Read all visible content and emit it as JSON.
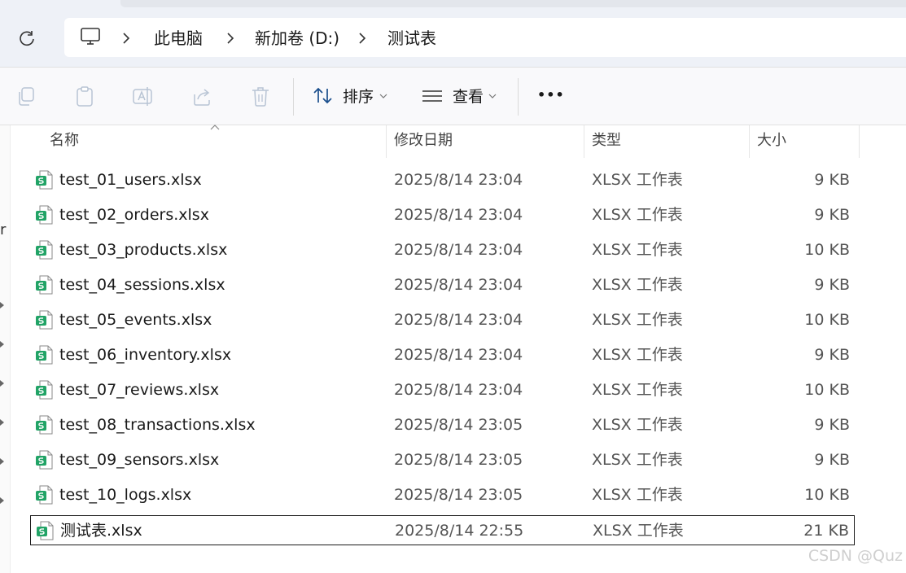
{
  "breadcrumb": {
    "items": [
      "此电脑",
      "新加卷 (D:)",
      "测试表"
    ]
  },
  "toolbar": {
    "sort_label": "排序",
    "view_label": "查看",
    "more_label": "•••"
  },
  "left_nav": {
    "partial_letter": "r"
  },
  "columns": {
    "name": "名称",
    "modified": "修改日期",
    "type": "类型",
    "size": "大小"
  },
  "files": [
    {
      "name": "test_01_users.xlsx",
      "modified": "2025/8/14 23:04",
      "type": "XLSX 工作表",
      "size": "9 KB"
    },
    {
      "name": "test_02_orders.xlsx",
      "modified": "2025/8/14 23:04",
      "type": "XLSX 工作表",
      "size": "9 KB"
    },
    {
      "name": "test_03_products.xlsx",
      "modified": "2025/8/14 23:04",
      "type": "XLSX 工作表",
      "size": "10 KB"
    },
    {
      "name": "test_04_sessions.xlsx",
      "modified": "2025/8/14 23:04",
      "type": "XLSX 工作表",
      "size": "9 KB"
    },
    {
      "name": "test_05_events.xlsx",
      "modified": "2025/8/14 23:04",
      "type": "XLSX 工作表",
      "size": "10 KB"
    },
    {
      "name": "test_06_inventory.xlsx",
      "modified": "2025/8/14 23:04",
      "type": "XLSX 工作表",
      "size": "9 KB"
    },
    {
      "name": "test_07_reviews.xlsx",
      "modified": "2025/8/14 23:04",
      "type": "XLSX 工作表",
      "size": "10 KB"
    },
    {
      "name": "test_08_transactions.xlsx",
      "modified": "2025/8/14 23:05",
      "type": "XLSX 工作表",
      "size": "9 KB"
    },
    {
      "name": "test_09_sensors.xlsx",
      "modified": "2025/8/14 23:05",
      "type": "XLSX 工作表",
      "size": "9 KB"
    },
    {
      "name": "test_10_logs.xlsx",
      "modified": "2025/8/14 23:05",
      "type": "XLSX 工作表",
      "size": "10 KB"
    },
    {
      "name": "测试表.xlsx",
      "modified": "2025/8/14 22:55",
      "type": "XLSX 工作表",
      "size": "21 KB"
    }
  ],
  "watermark": "CSDN @Quz",
  "colors": {
    "accent": "#0067c0",
    "excel_green": "#21a366",
    "selection_border": "#1a1a1a"
  }
}
